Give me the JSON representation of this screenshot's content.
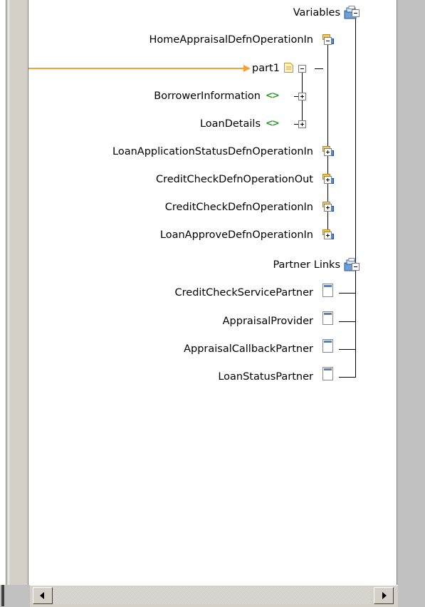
{
  "tree": {
    "variables_label": "Variables",
    "home_appraisal_in_label": "HomeAppraisalDefnOperationIn",
    "part1_label": "part1",
    "borrower_information_label": "BorrowerInformation",
    "loan_details_label": "LoanDetails",
    "loan_application_status_in_label": "LoanApplicationStatusDefnOperationIn",
    "credit_check_out_label": "CreditCheckDefnOperationOut",
    "credit_check_in_label": "CreditCheckDefnOperationIn",
    "loan_approve_in_label": "LoanApproveDefnOperationIn",
    "partner_links_label": "Partner Links",
    "credit_check_service_partner_label": "CreditCheckServicePartner",
    "appraisal_provider_label": "AppraisalProvider",
    "appraisal_callback_partner_label": "AppraisalCallbackPartner",
    "loan_status_partner_label": "LoanStatusPartner"
  },
  "icons": {
    "variables": "folder-stack-icon",
    "message": "message-variable-icon",
    "part": "message-part-icon",
    "element": "xml-element-icon",
    "partner_links": "folder-stack-icon",
    "partner_link": "partner-link-icon"
  },
  "colors": {
    "mapping_line": "#f5a030",
    "panel_bg": "#ffffff",
    "chrome": "#c0c0c0",
    "element_icon": "#2e9a2e"
  }
}
